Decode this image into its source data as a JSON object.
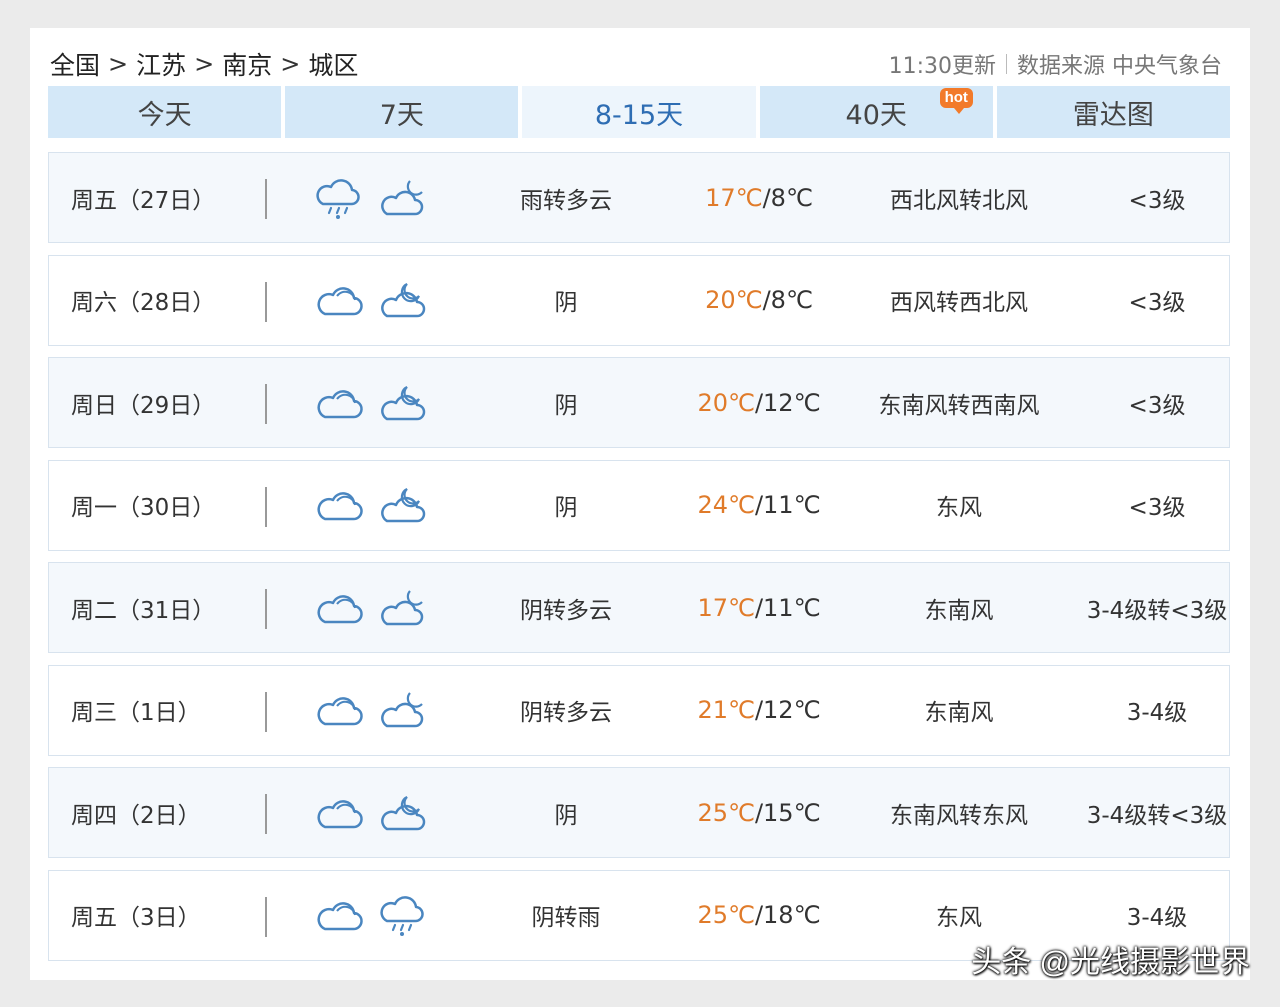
{
  "breadcrumb": {
    "items": [
      "全国",
      "江苏",
      "南京",
      "城区"
    ],
    "separator": ">"
  },
  "source": {
    "update": "11:30更新",
    "label": "数据来源 中央气象台"
  },
  "tabs": [
    {
      "label": "今天"
    },
    {
      "label": "7天"
    },
    {
      "label": "8-15天"
    },
    {
      "label": "40天",
      "badge": "hot"
    },
    {
      "label": "雷达图"
    }
  ],
  "active_tab": "8-15天",
  "colors": {
    "accent": "#2e6db3",
    "high_temp": "#e07b2a",
    "tab_bg": "#d4e8f8",
    "badge": "#f27a2a",
    "icon_stroke": "#4a86c0"
  },
  "forecast": [
    {
      "day": "周五（27日）",
      "icon_day": "rain-cloud-icon",
      "icon_night": "partly-cloudy-night-icon",
      "desc": "雨转多云",
      "high": "17℃",
      "low": "/8℃",
      "wind": "西北风转北风",
      "level": "<3级"
    },
    {
      "day": "周六（28日）",
      "icon_day": "cloud-icon",
      "icon_night": "cloudy-night-icon",
      "desc": "阴",
      "high": "20℃",
      "low": "/8℃",
      "wind": "西风转西北风",
      "level": "<3级"
    },
    {
      "day": "周日（29日）",
      "icon_day": "cloud-icon",
      "icon_night": "cloudy-night-icon",
      "desc": "阴",
      "high": "20℃",
      "low": "/12℃",
      "wind": "东南风转西南风",
      "level": "<3级"
    },
    {
      "day": "周一（30日）",
      "icon_day": "cloud-icon",
      "icon_night": "cloudy-night-icon",
      "desc": "阴",
      "high": "24℃",
      "low": "/11℃",
      "wind": "东风",
      "level": "<3级"
    },
    {
      "day": "周二（31日）",
      "icon_day": "cloud-icon",
      "icon_night": "partly-cloudy-night-icon",
      "desc": "阴转多云",
      "high": "17℃",
      "low": "/11℃",
      "wind": "东南风",
      "level": "3-4级转<3级"
    },
    {
      "day": "周三（1日）",
      "icon_day": "cloud-icon",
      "icon_night": "partly-cloudy-night-icon",
      "desc": "阴转多云",
      "high": "21℃",
      "low": "/12℃",
      "wind": "东南风",
      "level": "3-4级"
    },
    {
      "day": "周四（2日）",
      "icon_day": "cloud-icon",
      "icon_night": "cloudy-night-icon",
      "desc": "阴",
      "high": "25℃",
      "low": "/15℃",
      "wind": "东南风转东风",
      "level": "3-4级转<3级"
    },
    {
      "day": "周五（3日）",
      "icon_day": "cloud-icon",
      "icon_night": "rain-cloud-icon",
      "desc": "阴转雨",
      "high": "25℃",
      "low": "/18℃",
      "wind": "东风",
      "level": "3-4级"
    }
  ],
  "watermark": "头条 @光线摄影世界"
}
